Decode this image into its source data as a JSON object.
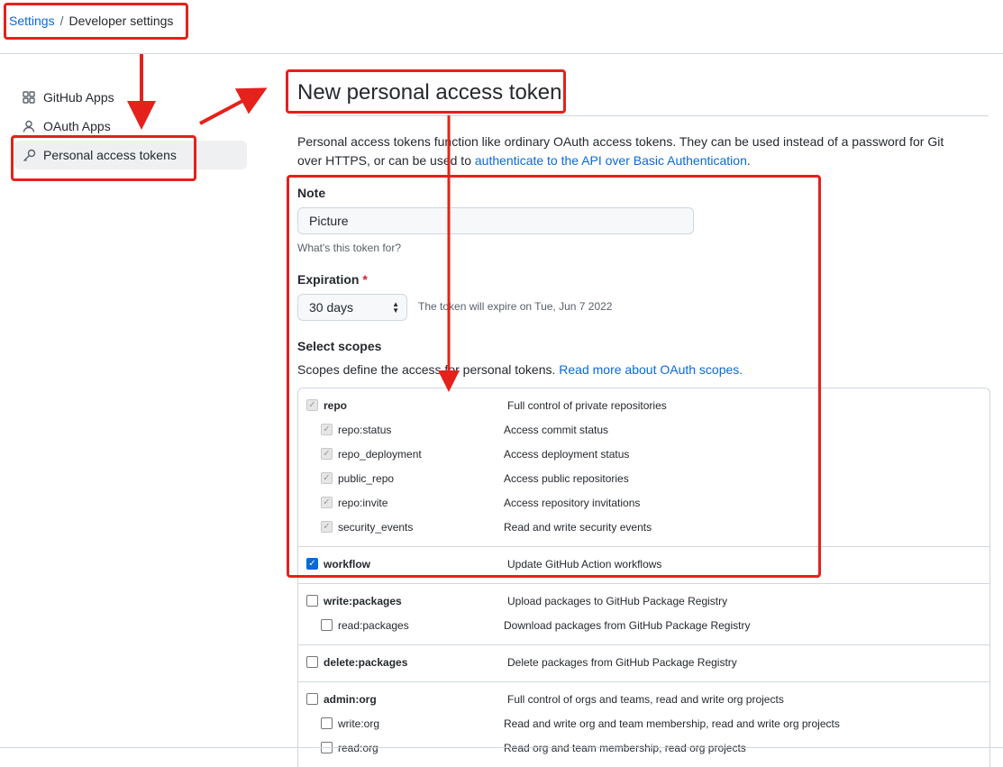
{
  "breadcrumb": {
    "settings": "Settings",
    "separator": "/",
    "current": "Developer settings"
  },
  "sidebar": {
    "items": [
      {
        "label": "GitHub Apps",
        "icon": "apps-grid-icon"
      },
      {
        "label": "OAuth Apps",
        "icon": "person-icon"
      },
      {
        "label": "Personal access tokens",
        "icon": "key-icon",
        "active": true
      }
    ]
  },
  "main": {
    "title": "New personal access token",
    "intro_text": "Personal access tokens function like ordinary OAuth access tokens. They can be used instead of a password for Git over HTTPS, or can be used to ",
    "intro_link": "authenticate to the API over Basic Authentication",
    "intro_end": ".",
    "note": {
      "label": "Note",
      "value": "Picture",
      "hint": "What's this token for?"
    },
    "expiration": {
      "label": "Expiration",
      "required_mark": "*",
      "value": "30 days",
      "note": "The token will expire on Tue, Jun 7 2022"
    },
    "scopes": {
      "label": "Select scopes",
      "desc_text": "Scopes define the access for personal tokens. ",
      "desc_link": "Read more about OAuth scopes.",
      "groups": [
        {
          "parent": {
            "name": "repo",
            "desc": "Full control of private repositories",
            "state": "disabled-checked"
          },
          "children": [
            {
              "name": "repo:status",
              "desc": "Access commit status",
              "state": "disabled-checked"
            },
            {
              "name": "repo_deployment",
              "desc": "Access deployment status",
              "state": "disabled-checked"
            },
            {
              "name": "public_repo",
              "desc": "Access public repositories",
              "state": "disabled-checked"
            },
            {
              "name": "repo:invite",
              "desc": "Access repository invitations",
              "state": "disabled-checked"
            },
            {
              "name": "security_events",
              "desc": "Read and write security events",
              "state": "disabled-checked"
            }
          ]
        },
        {
          "parent": {
            "name": "workflow",
            "desc": "Update GitHub Action workflows",
            "state": "checked"
          },
          "children": []
        },
        {
          "parent": {
            "name": "write:packages",
            "desc": "Upload packages to GitHub Package Registry",
            "state": "unchecked"
          },
          "children": [
            {
              "name": "read:packages",
              "desc": "Download packages from GitHub Package Registry",
              "state": "unchecked"
            }
          ]
        },
        {
          "parent": {
            "name": "delete:packages",
            "desc": "Delete packages from GitHub Package Registry",
            "state": "unchecked"
          },
          "children": []
        },
        {
          "parent": {
            "name": "admin:org",
            "desc": "Full control of orgs and teams, read and write org projects",
            "state": "unchecked"
          },
          "children": [
            {
              "name": "write:org",
              "desc": "Read and write org and team membership, read and write org projects",
              "state": "unchecked"
            },
            {
              "name": "read:org",
              "desc": "Read org and team membership, read org projects",
              "state": "unchecked"
            }
          ]
        }
      ]
    }
  },
  "colors": {
    "link": "#0969da",
    "annotation": "#e5211b",
    "required": "#cf222e",
    "checkbox": "#0969da"
  }
}
